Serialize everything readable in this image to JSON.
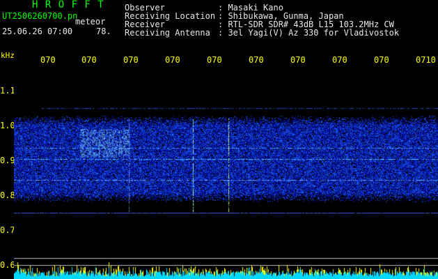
{
  "header": {
    "brand": "H R O F F T",
    "file": "UT2506260700.pn",
    "kind": "meteor",
    "date": "25.06.26 07:00",
    "rate": "78.",
    "fields": [
      {
        "label": "Observer",
        "value": ": Masaki Kano"
      },
      {
        "label": "Receiving Location",
        "value": ": Shibukawa, Gunma, Japan"
      },
      {
        "label": "Receiver",
        "value": ": RTL-SDR SDR# 43dB L15 103.2MHz CW"
      },
      {
        "label": "Receiving Antenna",
        "value": ": 3el Yagi(V) Az 330 for Vladivostok"
      }
    ]
  },
  "axis": {
    "y_unit": "kHz",
    "y_ticks": [
      "1.1",
      "1.0",
      "0.9",
      "0.8",
      "0.7",
      "0.6"
    ],
    "x_ticks": [
      "070",
      "070",
      "070",
      "070",
      "070",
      "070",
      "070",
      "070",
      "070",
      "0710"
    ]
  },
  "colors": {
    "header_green": "#00ff00",
    "tick_yellow": "#ffff00",
    "text_white": "#e8e8e8",
    "spectrum_blue": "#1a3cff"
  }
}
